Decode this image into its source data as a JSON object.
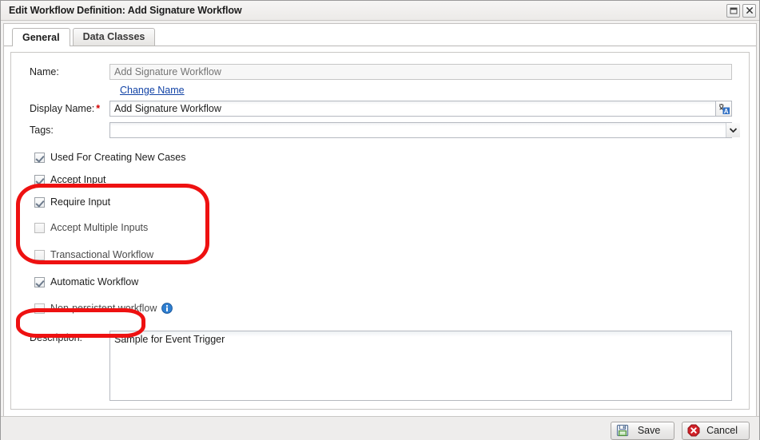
{
  "window": {
    "title": "Edit Workflow Definition: Add Signature Workflow",
    "restore_icon": "restore-window-icon",
    "close_icon": "close-window-icon"
  },
  "tabs": [
    {
      "label": "General",
      "active": true
    },
    {
      "label": "Data Classes",
      "active": false
    }
  ],
  "form": {
    "name_label": "Name:",
    "name_value": "",
    "name_placeholder": "Add Signature Workflow",
    "change_name_link": "Change Name",
    "display_name_label": "Display Name:",
    "display_name_required_marker": "*",
    "display_name_value": "Add Signature Workflow",
    "localize_icon": "localize-icon",
    "tags_label": "Tags:",
    "tags_value": "",
    "tags_dropdown_icon": "chevron-down-icon",
    "description_label": "Description:",
    "description_value": "Sample for Event Trigger"
  },
  "checkboxes": [
    {
      "label": "Used For Creating New Cases",
      "checked": true,
      "indent": 0
    },
    {
      "label": "Accept Input",
      "checked": true,
      "indent": 0
    },
    {
      "label": "Require Input",
      "checked": true,
      "indent": 1
    },
    {
      "label": "Accept Multiple Inputs",
      "checked": false,
      "indent": 1
    },
    {
      "label": "Transactional Workflow",
      "checked": false,
      "indent": 0
    },
    {
      "label": "Automatic Workflow",
      "checked": true,
      "indent": 0
    },
    {
      "label": "Non-persistent workflow",
      "checked": false,
      "indent": 1,
      "info_icon": "info-icon"
    }
  ],
  "footer": {
    "save_label": "Save",
    "save_icon": "save-disk-icon",
    "cancel_label": "Cancel",
    "cancel_icon": "cancel-x-icon"
  },
  "annotations": [
    {
      "name": "highlight-input-options",
      "shape": "rounded-rectangle",
      "color": "#ee1111"
    },
    {
      "name": "highlight-automatic-workflow",
      "shape": "ellipse",
      "color": "#ee1111"
    }
  ],
  "colors": {
    "accent_link": "#1243a6",
    "required_star": "#d40000",
    "annotation_red": "#ee1111",
    "info_blue": "#2f7fd1"
  }
}
